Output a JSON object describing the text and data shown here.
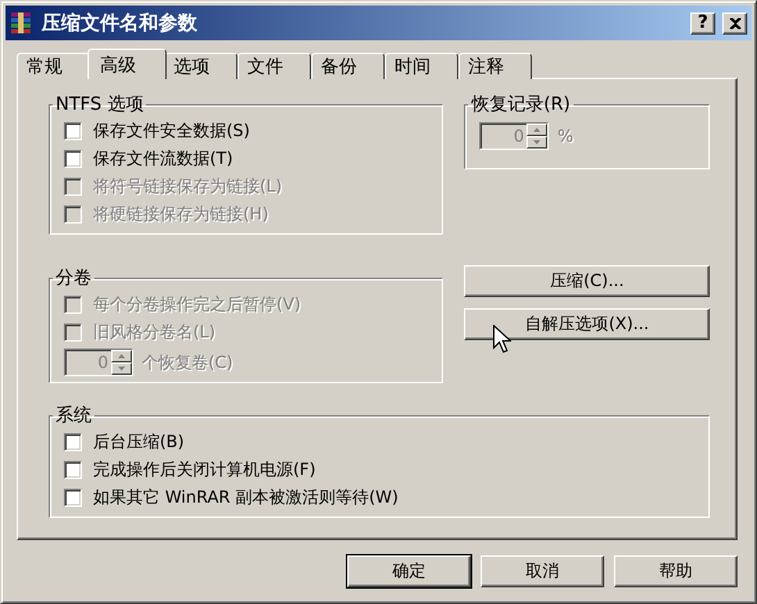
{
  "window": {
    "title": "压缩文件名和参数",
    "help_button": "?"
  },
  "tabs": [
    {
      "label": "常规",
      "selected": false
    },
    {
      "label": "高级",
      "selected": true
    },
    {
      "label": "选项",
      "selected": false
    },
    {
      "label": "文件",
      "selected": false
    },
    {
      "label": "备份",
      "selected": false
    },
    {
      "label": "时间",
      "selected": false
    },
    {
      "label": "注释",
      "selected": false
    }
  ],
  "ntfs": {
    "title": "NTFS 选项",
    "options": [
      {
        "label": "保存文件安全数据(S)",
        "checked": false,
        "disabled": false
      },
      {
        "label": "保存文件流数据(T)",
        "checked": false,
        "disabled": false
      },
      {
        "label": "将符号链接保存为链接(L)",
        "checked": false,
        "disabled": true
      },
      {
        "label": "将硬链接保存为链接(H)",
        "checked": false,
        "disabled": true
      }
    ]
  },
  "recovery": {
    "title": "恢复记录(R)",
    "value": "0",
    "unit": "%",
    "disabled": true
  },
  "volumes": {
    "title": "分卷",
    "options": [
      {
        "label": "每个分卷操作完之后暂停(V)",
        "checked": false,
        "disabled": true
      },
      {
        "label": "旧风格分卷名(L)",
        "checked": false,
        "disabled": true
      }
    ],
    "spinner": {
      "value": "0",
      "label": "个恢复卷(C)",
      "disabled": true
    }
  },
  "side_buttons": [
    "压缩(C)...",
    "自解压选项(X)..."
  ],
  "system": {
    "title": "系统",
    "options": [
      {
        "label": "后台压缩(B)",
        "checked": false,
        "disabled": false
      },
      {
        "label": "完成操作后关闭计算机电源(F)",
        "checked": false,
        "disabled": false
      },
      {
        "label": "如果其它 WinRAR 副本被激活则等待(W)",
        "checked": false,
        "disabled": false
      }
    ]
  },
  "footer_buttons": [
    {
      "label": "确定",
      "default": true
    },
    {
      "label": "取消",
      "default": false
    },
    {
      "label": "帮助",
      "default": false
    }
  ]
}
